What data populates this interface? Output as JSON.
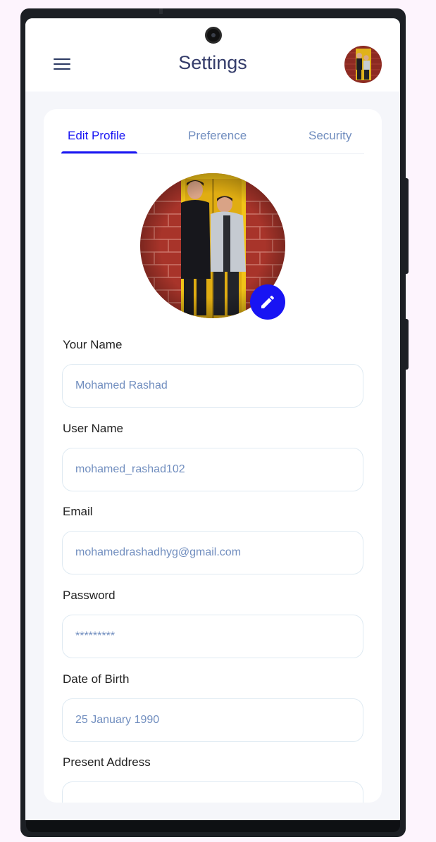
{
  "header": {
    "title": "Settings"
  },
  "tabs": [
    {
      "label": "Edit Profile",
      "active": true
    },
    {
      "label": "Preference",
      "active": false
    },
    {
      "label": "Security",
      "active": false
    }
  ],
  "profile": {
    "picture_icon": "profile-photo",
    "edit_icon": "pencil-icon"
  },
  "fields": {
    "your_name": {
      "label": "Your Name",
      "value": "Mohamed Rashad"
    },
    "user_name": {
      "label": "User Name",
      "value": "mohamed_rashad102"
    },
    "email": {
      "label": "Email",
      "value": "mohamedrashadhyg@gmail.com"
    },
    "password": {
      "label": "Password",
      "value": "*********"
    },
    "date_of_birth": {
      "label": "Date of Birth",
      "value": "25 January 1990"
    },
    "present_address": {
      "label": "Present Address",
      "value": ""
    }
  },
  "colors": {
    "accent": "#1814f3",
    "title": "#343c6a",
    "muted": "#718ebf",
    "background": "#f5f6fa"
  }
}
